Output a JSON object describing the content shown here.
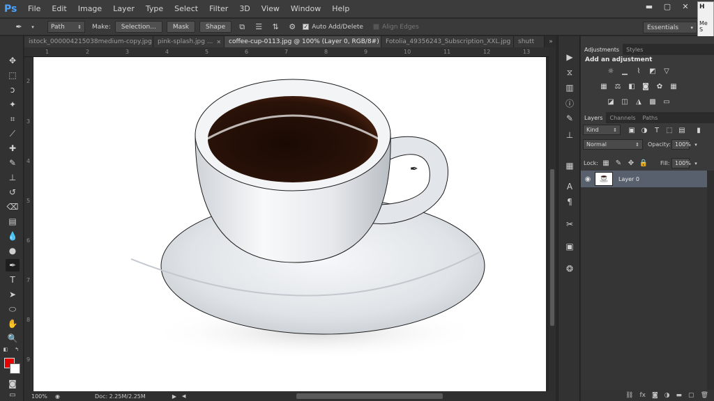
{
  "app": {
    "logo": "Ps"
  },
  "menu": [
    "File",
    "Edit",
    "Image",
    "Layer",
    "Type",
    "Select",
    "Filter",
    "3D",
    "View",
    "Window",
    "Help"
  ],
  "window_controls": {
    "minimize": "▬",
    "maximize": "▢",
    "close": "✕"
  },
  "popup": {
    "title": "H",
    "line1": "Me",
    "line2": "S"
  },
  "options": {
    "tool_icon": "pen-icon",
    "mode": "Path",
    "make_label": "Make:",
    "selection_btn": "Selection...",
    "mask_btn": "Mask",
    "shape_btn": "Shape",
    "auto_add_delete": "Auto Add/Delete",
    "align_edges": "Align Edges",
    "workspace": "Essentials"
  },
  "tabs": [
    {
      "label": "istock_000004215038medium-copy.jpg",
      "close": "✕",
      "active": false
    },
    {
      "label": "pink-splash.jpg ...",
      "close": "✕",
      "active": false
    },
    {
      "label": "coffee-cup-0113.jpg @ 100% (Layer 0, RGB/8#) *",
      "close": "✕",
      "active": true
    },
    {
      "label": "Fotolia_49356243_Subscription_XXL.jpg",
      "close": "✕",
      "active": false
    },
    {
      "label": "shutt",
      "close": "",
      "active": false
    }
  ],
  "tabs_more": "»",
  "ruler_top": [
    "1",
    "2",
    "3",
    "4",
    "5",
    "6",
    "7",
    "8",
    "9",
    "10",
    "11",
    "12",
    "13"
  ],
  "ruler_left": [
    "2",
    "3",
    "4",
    "5",
    "6",
    "7",
    "8",
    "9"
  ],
  "status": {
    "zoom": "100%",
    "doc": "Doc: 2.25M/2.25M"
  },
  "panels": {
    "top_tabs": [
      "Adjustments",
      "Styles"
    ],
    "adjust_title": "Add an adjustment",
    "layers_tabs": [
      "Layers",
      "Channels",
      "Paths"
    ],
    "kind": "Kind",
    "blend_mode": "Normal",
    "opacity_label": "Opacity:",
    "opacity_value": "100%",
    "lock_label": "Lock:",
    "fill_label": "Fill:",
    "fill_value": "100%",
    "layer_name": "Layer 0"
  },
  "colors": {
    "foreground": "#e60000",
    "background": "#ffffff",
    "accent": "#58606e"
  }
}
